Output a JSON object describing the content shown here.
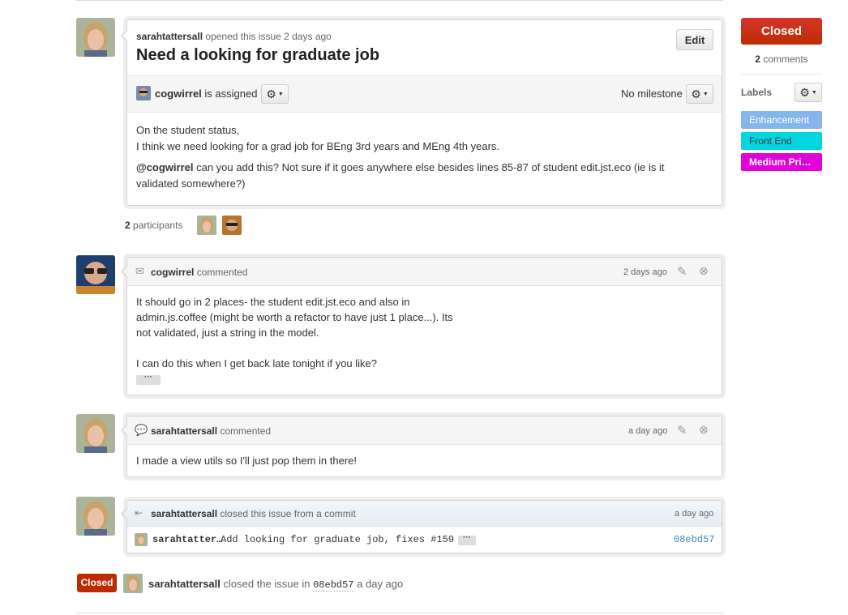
{
  "issue": {
    "author": "sarahtattersall",
    "opened_text": "opened this issue 2 days ago",
    "title": "Need a looking for graduate job",
    "edit_label": "Edit",
    "assignee": "cogwirrel",
    "assigned_text": "is assigned",
    "milestone_text": "No milestone",
    "body_line1": "On the student status,",
    "body_line2": "I think we need looking for a grad job for BEng 3rd years and MEng 4th years.",
    "body_mention": "@cogwirrel",
    "body_line3a": " can you add this? Not sure if it goes anywhere else besides lines 85-87 of student edit.jst.eco (ie is it",
    "body_line3b": "validated somewhere?)"
  },
  "participants": {
    "count": "2",
    "label": "participants"
  },
  "comments": [
    {
      "author": "cogwirrel",
      "action": "commented",
      "time": "2 days ago",
      "lines": [
        "It should go in 2 places- the student edit.jst.eco and also in",
        "admin.js.coffee (might be worth a refactor to have just 1 place...). Its",
        "not validated, just a string in the model.",
        "I can do this when I get back late tonight if you like?"
      ],
      "ellipsis": "···"
    },
    {
      "author": "sarahtattersall",
      "action": "commented",
      "time": "a day ago",
      "lines": [
        "I made a view utils so I'll just pop them in there!"
      ]
    }
  ],
  "close_event": {
    "author": "sarahtattersall",
    "action": "closed this issue from a commit",
    "time": "a day ago",
    "commit_author": "sarahtatter…",
    "commit_message": "Add looking for graduate job, fixes #159",
    "commit_ellipsis": "···",
    "commit_sha": "08ebd57"
  },
  "footer_event": {
    "badge": "Closed",
    "author": "sarahtattersall",
    "text_before": "closed the issue in",
    "sha": "08ebd57",
    "text_after": "a day ago"
  },
  "sidebar": {
    "state_label": "Closed",
    "comments_count": "2",
    "comments_label": "comments",
    "labels_title": "Labels",
    "labels": [
      {
        "name": "Enhancement",
        "color": "#84b6eb",
        "text_color": "#ffffff"
      },
      {
        "name": "Front End",
        "color": "#02d7e1",
        "text_color": "#333333"
      },
      {
        "name": "Medium Pri…",
        "color": "#e102d8",
        "text_color": "#ffffff"
      }
    ]
  },
  "colors": {
    "closed_red": "#bd2c00",
    "link_blue": "#4183c4"
  }
}
